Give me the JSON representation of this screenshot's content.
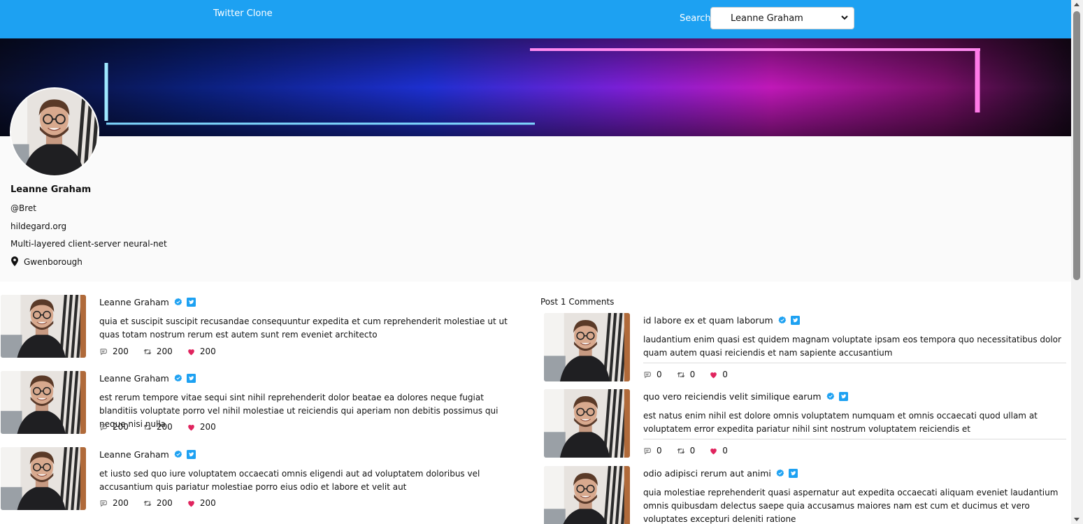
{
  "header": {
    "brand": "Twitter Clone",
    "search_label": "Search",
    "search_selected": "Leanne Graham"
  },
  "profile": {
    "name": "Leanne Graham",
    "handle": "@Bret",
    "website": "hildegard.org",
    "bio": "Multi-layered client-server neural-net",
    "location": "Gwenborough"
  },
  "posts": [
    {
      "author": "Leanne Graham",
      "body": "quia et suscipit suscipit recusandae consequuntur expedita et cum reprehenderit molestiae ut ut quas totam nostrum rerum est autem sunt rem eveniet architecto",
      "comments": "200",
      "retweets": "200",
      "likes": "200"
    },
    {
      "author": "Leanne Graham",
      "body": "est rerum tempore vitae sequi sint nihil reprehenderit dolor beatae ea dolores neque fugiat blanditiis voluptate porro vel nihil molestiae ut reiciendis qui aperiam non debitis possimus qui neque nisi nulla",
      "comments": "200",
      "retweets": "200",
      "likes": "200"
    },
    {
      "author": "Leanne Graham",
      "body": "et iusto sed quo iure voluptatem occaecati omnis eligendi aut ad voluptatem doloribus vel accusantium quis pariatur molestiae porro eius odio et labore et velit aut",
      "comments": "200",
      "retweets": "200",
      "likes": "200"
    }
  ],
  "comments_panel": {
    "title": "Post 1 Comments",
    "items": [
      {
        "name": "id labore ex et quam laborum",
        "body": "laudantium enim quasi est quidem magnam voluptate ipsam eos tempora quo necessitatibus dolor quam autem quasi reiciendis et nam sapiente accusantium",
        "comments": "0",
        "retweets": "0",
        "likes": "0"
      },
      {
        "name": "quo vero reiciendis velit similique earum",
        "body": "est natus enim nihil est dolore omnis voluptatem numquam et omnis occaecati quod ullam at voluptatem error expedita pariatur nihil sint nostrum voluptatem reiciendis et",
        "comments": "0",
        "retweets": "0",
        "likes": "0"
      },
      {
        "name": "odio adipisci rerum aut animi",
        "body": "quia molestiae reprehenderit quasi aspernatur aut expedita occaecati aliquam eveniet laudantium omnis quibusdam delectus saepe quia accusamus maiores nam est cum et ducimus et vero voluptates excepturi deleniti ratione",
        "comments": "",
        "retweets": "",
        "likes": ""
      }
    ]
  },
  "icons": {
    "verified": "verified-badge-icon",
    "twitter": "twitter-bird-icon",
    "comment": "comment-icon",
    "retweet": "retweet-icon",
    "like": "heart-icon",
    "location": "map-pin-icon"
  },
  "colors": {
    "header_bg": "#1da1f2",
    "verified": "#1da1f2",
    "like": "#e0245e"
  }
}
